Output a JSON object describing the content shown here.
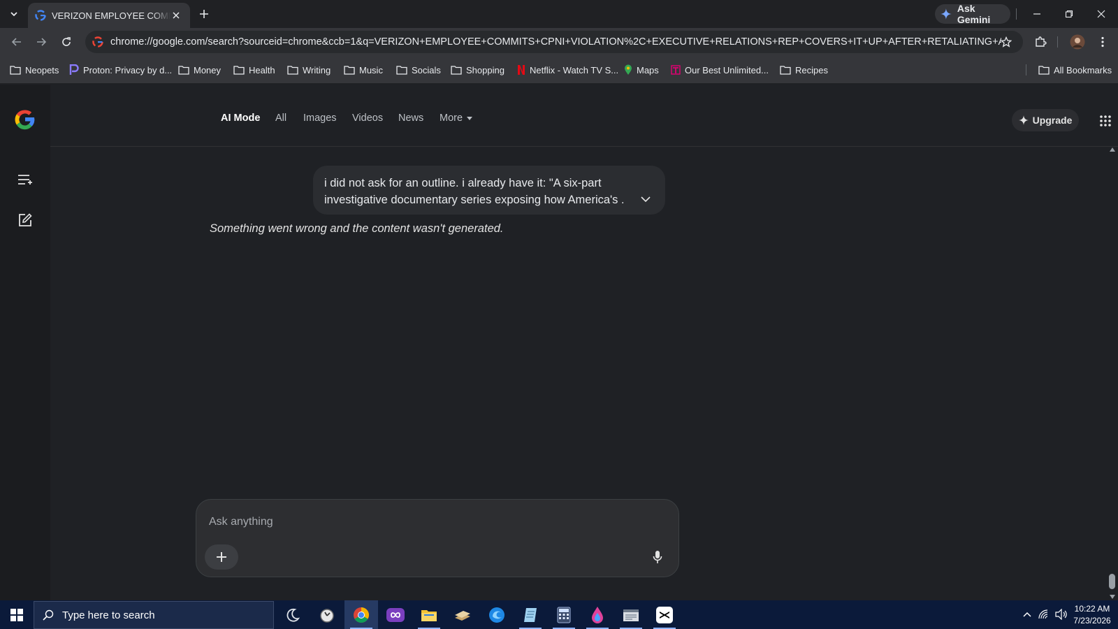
{
  "browser": {
    "tab": {
      "title": "VERIZON EMPLOYEE COMMITS",
      "favicon": "google-g-icon"
    },
    "ask_gemini_label": "Ask Gemini",
    "url": "chrome://google.com/search?sourceid=chrome&ccb=1&q=VERIZON+EMPLOYEE+COMMITS+CPNI+VIOLATION%2C+EXECUTIVE+RELATIONS+REP+COVERS+IT+UP+AFTER+RETALIATING+AGAINST+A..."
  },
  "bookmarks": [
    {
      "label": "Neopets",
      "icon": "folder-icon"
    },
    {
      "label": "Proton: Privacy by d...",
      "icon": "proton-icon"
    },
    {
      "label": "Money",
      "icon": "folder-icon"
    },
    {
      "label": "Health",
      "icon": "folder-icon"
    },
    {
      "label": "Writing",
      "icon": "folder-icon"
    },
    {
      "label": "Music",
      "icon": "folder-icon"
    },
    {
      "label": "Socials",
      "icon": "folder-icon"
    },
    {
      "label": "Shopping",
      "icon": "folder-icon"
    },
    {
      "label": "Netflix - Watch TV S...",
      "icon": "netflix-icon"
    },
    {
      "label": "Maps",
      "icon": "maps-icon"
    },
    {
      "label": "Our Best Unlimited...",
      "icon": "tmobile-icon"
    },
    {
      "label": "Recipes",
      "icon": "folder-icon"
    }
  ],
  "all_bookmarks_label": "All Bookmarks",
  "header": {
    "nav": [
      "AI Mode",
      "All",
      "Images",
      "Videos",
      "News",
      "More"
    ],
    "upgrade_label": "Upgrade"
  },
  "conversation": {
    "user_message_line1": "i did not ask for an outline. i already have it: \"A six-part",
    "user_message_line2": "investigative documentary series exposing how America's ...",
    "error_text": "Something went wrong and the content wasn't generated."
  },
  "composer": {
    "placeholder": "Ask anything"
  },
  "taskbar": {
    "search_placeholder": "Type here to search",
    "time": "10:22 AM",
    "date": "7/23/2026"
  },
  "colors": {
    "accent_blue": "#8ab4f8",
    "taskbar": "#0b1a3a"
  }
}
